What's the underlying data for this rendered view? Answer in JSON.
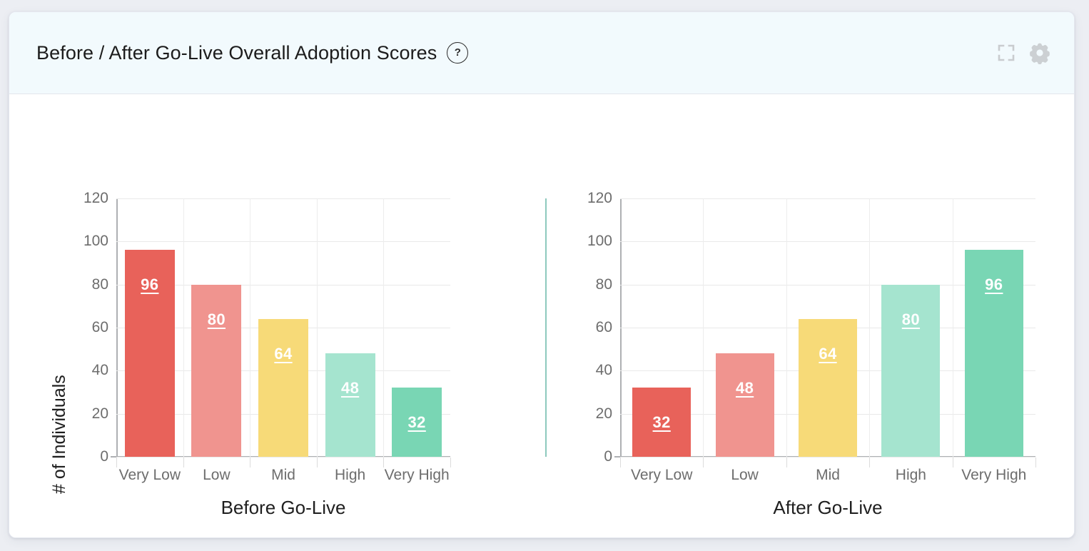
{
  "page": {
    "background_color": "#eceef3",
    "card_background": "#ffffff",
    "header_background": "#f2fafd"
  },
  "header": {
    "title": "Before / After Go-Live Overall Adoption Scores",
    "help_label": "?",
    "actions": [
      {
        "name": "expand-icon",
        "label": "Expand"
      },
      {
        "name": "gear-icon",
        "label": "Settings"
      }
    ]
  },
  "palette": {
    "very_low": "#e8625a",
    "low": "#f0948f",
    "mid": "#f7da78",
    "high": "#a5e4cf",
    "very_high": "#79d6b4",
    "divider": "#79bfb2",
    "axis": "#aeb0b3",
    "grid": "#e9e9e9",
    "tick_text": "#6d6d6d",
    "title_text": "#1f1f1f"
  },
  "chart_data": [
    {
      "type": "bar",
      "title": "Before Go-Live",
      "xlabel": "Before Go-Live",
      "ylabel": "# of Individuals",
      "ylim": [
        0,
        120
      ],
      "yticks": [
        0,
        20,
        40,
        60,
        80,
        100,
        120
      ],
      "grid": true,
      "legend": "none",
      "categories": [
        "Very Low",
        "Low",
        "Mid",
        "High",
        "Very High"
      ],
      "values": [
        96,
        80,
        64,
        48,
        32
      ],
      "colors": [
        "#e8625a",
        "#f0948f",
        "#f7da78",
        "#a5e4cf",
        "#79d6b4"
      ]
    },
    {
      "type": "bar",
      "title": "After Go-Live",
      "xlabel": "After Go-Live",
      "ylabel": "",
      "ylim": [
        0,
        120
      ],
      "yticks": [
        0,
        20,
        40,
        60,
        80,
        100,
        120
      ],
      "grid": true,
      "legend": "none",
      "categories": [
        "Very Low",
        "Low",
        "Mid",
        "High",
        "Very High"
      ],
      "values": [
        32,
        48,
        64,
        80,
        96
      ],
      "colors": [
        "#e8625a",
        "#f0948f",
        "#f7da78",
        "#a5e4cf",
        "#79d6b4"
      ]
    }
  ]
}
